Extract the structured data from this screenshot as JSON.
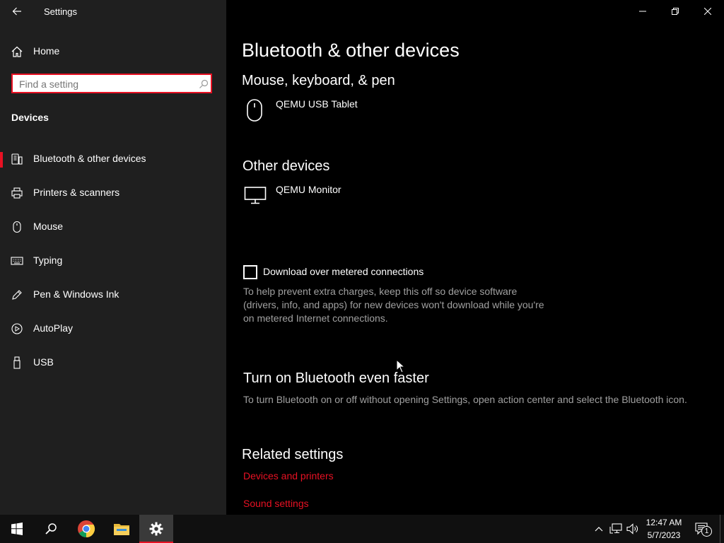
{
  "window": {
    "title": "Settings",
    "controls": {
      "minimize": "minimize-icon",
      "restore": "restore-icon",
      "close": "close-icon"
    }
  },
  "sidebar": {
    "home_label": "Home",
    "search": {
      "placeholder": "Find a setting",
      "value": ""
    },
    "section_title": "Devices",
    "items": [
      {
        "label": "Bluetooth & other devices",
        "icon": "bluetooth-devices-icon",
        "selected": true
      },
      {
        "label": "Printers & scanners",
        "icon": "printer-icon"
      },
      {
        "label": "Mouse",
        "icon": "mouse-icon"
      },
      {
        "label": "Typing",
        "icon": "keyboard-icon"
      },
      {
        "label": "Pen & Windows Ink",
        "icon": "pen-icon"
      },
      {
        "label": "AutoPlay",
        "icon": "autoplay-icon"
      },
      {
        "label": "USB",
        "icon": "usb-icon"
      }
    ]
  },
  "main": {
    "page_title": "Bluetooth & other devices",
    "mouse_section": {
      "heading": "Mouse, keyboard, & pen",
      "devices": [
        {
          "name": "QEMU USB Tablet",
          "icon": "mouse-icon"
        }
      ]
    },
    "other_section": {
      "heading": "Other devices",
      "devices": [
        {
          "name": "QEMU Monitor",
          "icon": "monitor-icon"
        }
      ]
    },
    "metered": {
      "checkbox_label": "Download over metered connections",
      "checked": false,
      "description": "To help prevent extra charges, keep this off so device software (drivers, info, and apps) for new devices won't download while you're on metered Internet connections."
    },
    "faster": {
      "heading": "Turn on Bluetooth even faster",
      "description": "To turn Bluetooth on or off without opening Settings, open action center and select the Bluetooth icon."
    },
    "related": {
      "heading": "Related settings",
      "links": [
        {
          "label": "Devices and printers"
        },
        {
          "label": "Sound settings"
        }
      ]
    }
  },
  "taskbar": {
    "apps": [
      "start-icon",
      "search-icon",
      "chrome-icon",
      "file-explorer-icon",
      "settings-icon"
    ],
    "active_app": "settings-icon",
    "clock": {
      "time": "12:47 AM",
      "date": "5/7/2023"
    },
    "notifications_count": "1"
  },
  "colors": {
    "accent": "#e81123",
    "sidebar_bg": "#1f1f1f",
    "main_bg": "#000000",
    "taskbar_bg": "#101010",
    "muted_text": "#a0a0a0"
  }
}
